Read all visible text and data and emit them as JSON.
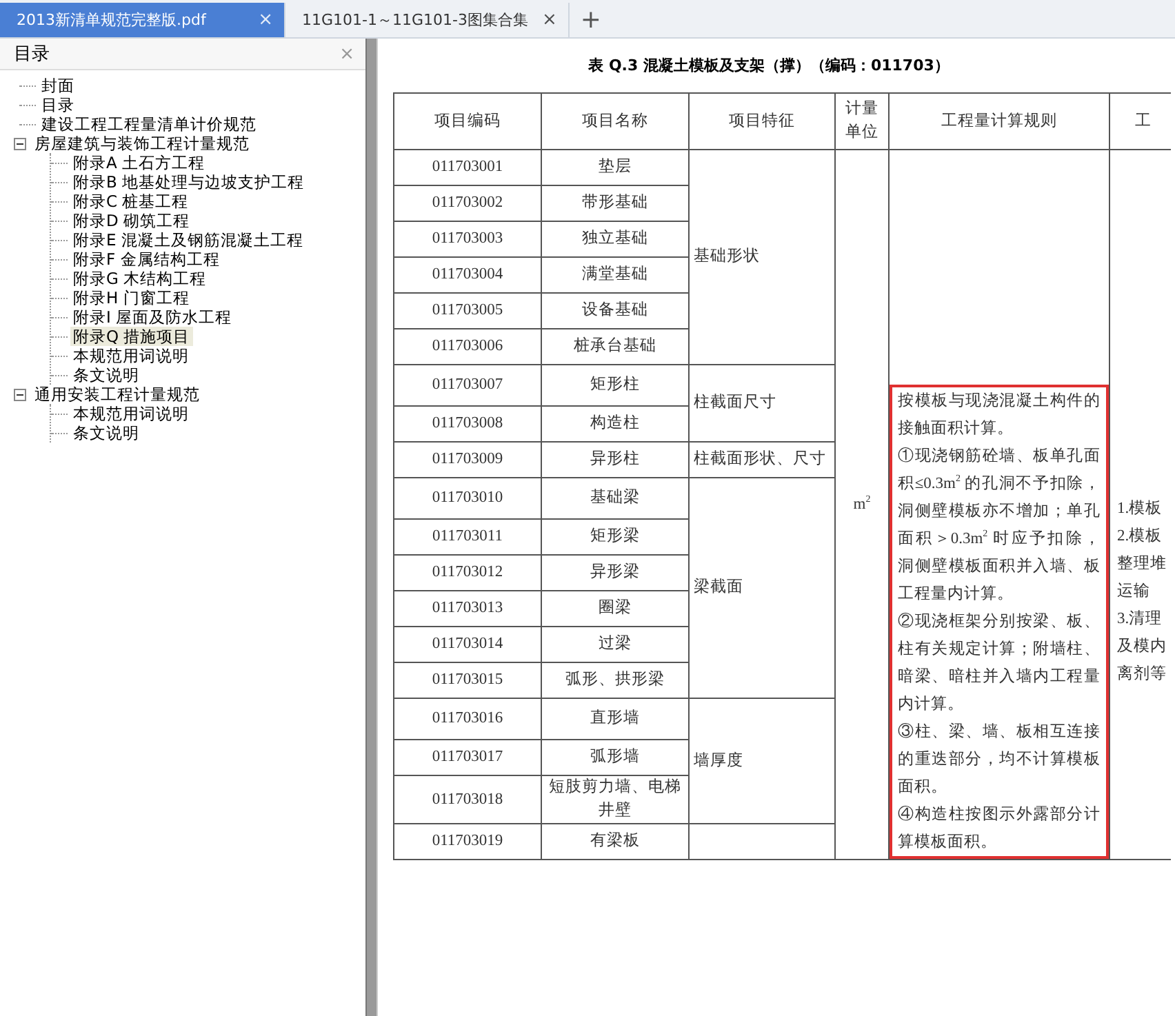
{
  "tabs": [
    {
      "label": "2013新清单规范完整版.pdf",
      "close": "×",
      "selected": true
    },
    {
      "label": "11G101-1～11G101-3图集合集",
      "close": "×",
      "selected": false
    }
  ],
  "new_tab": "+",
  "sidebar": {
    "title": "目录",
    "close": "×",
    "items": [
      {
        "label": "封面",
        "selected": false
      },
      {
        "label": "目录",
        "selected": false
      },
      {
        "label": "建设工程工程量清单计价规范",
        "selected": false
      },
      {
        "label": "房屋建筑与装饰工程计量规范",
        "selected": false,
        "expanded": true,
        "children": [
          {
            "label": "附录A 土石方工程",
            "selected": false
          },
          {
            "label": "附录B 地基处理与边坡支护工程",
            "selected": false
          },
          {
            "label": "附录C 桩基工程",
            "selected": false
          },
          {
            "label": "附录D 砌筑工程",
            "selected": false
          },
          {
            "label": "附录E 混凝土及钢筋混凝土工程",
            "selected": false
          },
          {
            "label": "附录F 金属结构工程",
            "selected": false
          },
          {
            "label": "附录G 木结构工程",
            "selected": false
          },
          {
            "label": "附录H 门窗工程",
            "selected": false
          },
          {
            "label": "附录I 屋面及防水工程",
            "selected": false
          },
          {
            "label": "附录Q 措施项目",
            "selected": true
          },
          {
            "label": "本规范用词说明",
            "selected": false
          },
          {
            "label": "条文说明",
            "selected": false
          }
        ]
      },
      {
        "label": "通用安装工程计量规范",
        "selected": false,
        "expanded": true,
        "children": [
          {
            "label": "本规范用词说明",
            "selected": false
          },
          {
            "label": "条文说明",
            "selected": false
          }
        ]
      }
    ]
  },
  "document": {
    "title": "表 Q.3 混凝土模板及支架（撑）（编码：011703）",
    "table": {
      "columns": [
        "项目编码",
        "项目名称",
        "项目特征",
        "计量单位",
        "工程量计算规则",
        "工"
      ],
      "groups": [
        {
          "feature": "基础形状",
          "rows": [
            {
              "code": "011703001",
              "name": "垫层"
            },
            {
              "code": "011703002",
              "name": "带形基础"
            },
            {
              "code": "011703003",
              "name": "独立基础"
            },
            {
              "code": "011703004",
              "name": "满堂基础"
            },
            {
              "code": "011703005",
              "name": "设备基础"
            },
            {
              "code": "011703006",
              "name": "桩承台基础"
            }
          ]
        },
        {
          "feature": "柱截面尺寸",
          "rows": [
            {
              "code": "011703007",
              "name": "矩形柱"
            },
            {
              "code": "011703008",
              "name": "构造柱"
            }
          ]
        },
        {
          "feature": "柱截面形状、尺寸",
          "rows": [
            {
              "code": "011703009",
              "name": "异形柱"
            }
          ]
        },
        {
          "feature": "梁截面",
          "rows": [
            {
              "code": "011703010",
              "name": "基础梁"
            },
            {
              "code": "011703011",
              "name": "矩形梁"
            },
            {
              "code": "011703012",
              "name": "异形梁"
            },
            {
              "code": "011703013",
              "name": "圈梁"
            },
            {
              "code": "011703014",
              "name": "过梁"
            },
            {
              "code": "011703015",
              "name": "弧形、拱形梁"
            }
          ]
        },
        {
          "feature": "墙厚度",
          "rows": [
            {
              "code": "011703016",
              "name": "直形墙"
            },
            {
              "code": "011703017",
              "name": "弧形墙"
            },
            {
              "code": "011703018",
              "name": "短肢剪力墙、电梯井壁"
            }
          ]
        },
        {
          "rows": [
            {
              "code": "011703019",
              "name": "有梁板"
            }
          ]
        }
      ],
      "unit": "m$^{2}$",
      "rules": {
        "highlighted": true,
        "paragraphs": [
          "按模板与现浇混凝土构件的接触面积计算。",
          "①现浇钢筋砼墙、板单孔面积≤0.3m$^{2}$ 的孔洞不予扣除，洞侧壁模板亦不增加；单孔面积＞0.3m$^{2}$ 时应予扣除，洞侧壁模板面积并入墙、板工程量内计算。",
          "②现浇框架分别按梁、板、柱有关规定计算；附墙柱、暗梁、暗柱并入墙内工程量内计算。",
          "③柱、梁、墙、板相互连接的重迭部分，均不计算模板面积。",
          "④构造柱按图示外露部分计算模板面积。"
        ]
      },
      "work_lines": [
        "1.模板",
        "2.模板",
        "整理堆",
        "运输",
        "3.清理",
        "及模内",
        "离剂等"
      ]
    }
  }
}
